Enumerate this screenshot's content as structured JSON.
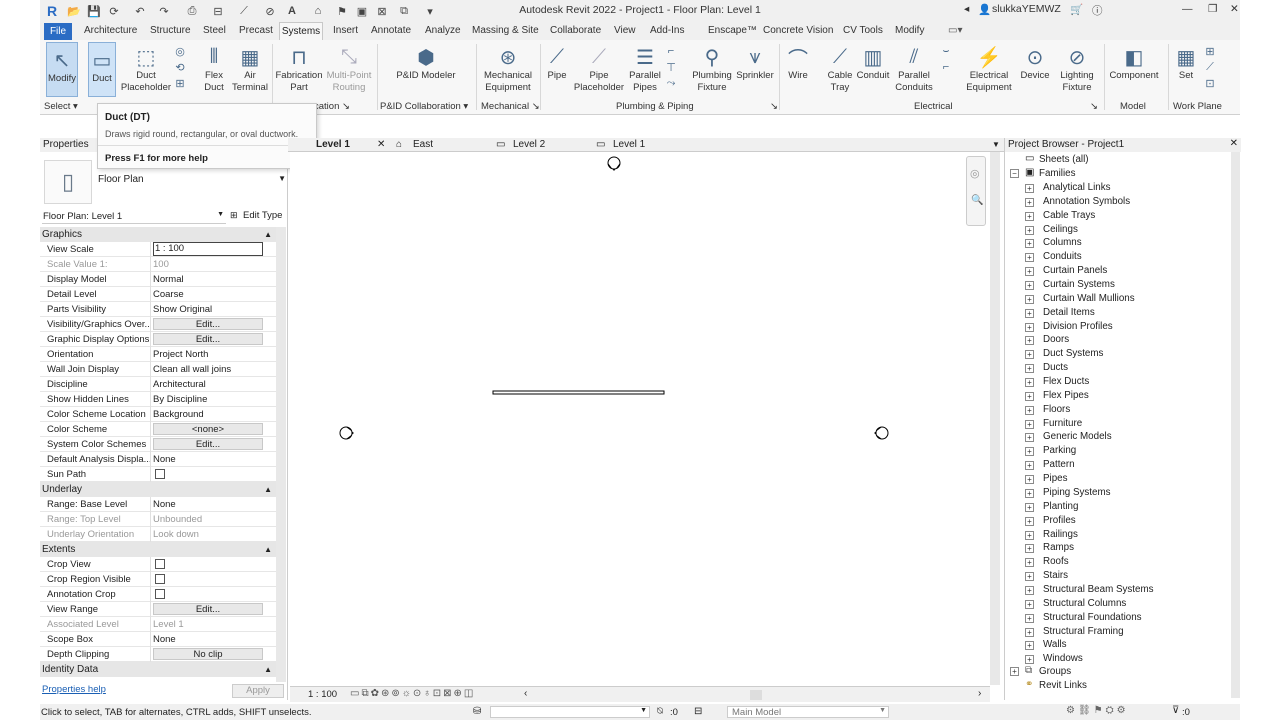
{
  "app": {
    "title": "Autodesk Revit 2022 - Project1 - Floor Plan: Level 1",
    "user": "slukkaYEMWZ",
    "logo": "R"
  },
  "tabs": [
    "File",
    "Architecture",
    "Structure",
    "Steel",
    "Precast",
    "Systems",
    "Insert",
    "Annotate",
    "Analyze",
    "Massing & Site",
    "Collaborate",
    "View",
    "Add-Ins",
    "Enscape™",
    "Concrete Vision",
    "CV Tools",
    "Modify"
  ],
  "ribbon": {
    "buttons": {
      "modify": "Modify",
      "duct": "Duct",
      "duct_placeholder": "Duct\nPlaceholder",
      "flex_duct": "Flex\nDuct",
      "air_terminal": "Air\nTerminal",
      "fabrication_part": "Fabrication\nPart",
      "multi_point_routing": "Multi-Point\nRouting",
      "pid_modeler": "P&ID Modeler",
      "mechanical_equipment": "Mechanical\nEquipment",
      "pipe": "Pipe",
      "pipe_placeholder": "Pipe\nPlaceholder",
      "parallel_pipes": "Parallel\nPipes",
      "plumbing_fixture": "Plumbing\nFixture",
      "sprinkler": "Sprinkler",
      "wire": "Wire",
      "cable_tray": "Cable\nTray",
      "conduit": "Conduit",
      "parallel_conduits": "Parallel\nConduits",
      "electrical_equipment": "Electrical\nEquipment",
      "device": "Device",
      "lighting_fixture": "Lighting\nFixture",
      "component": "Component",
      "set": "Set"
    },
    "panels": {
      "select": "Select",
      "fabrication": "cation",
      "pid": "P&ID Collaboration",
      "mechanical": "Mechanical",
      "plumbing": "Plumbing & Piping",
      "electrical": "Electrical",
      "model": "Model",
      "workplane": "Work Plane"
    }
  },
  "tooltip": {
    "title": "Duct (DT)",
    "description": "Draws rigid round, rectangular, or oval ductwork.",
    "help": "Press F1 for more help"
  },
  "properties": {
    "header": "Properties",
    "type": "Floor Plan",
    "instance": "Floor Plan: Level 1",
    "edit_type": "Edit Type",
    "help_link": "Properties help",
    "apply": "Apply",
    "sections": {
      "graphics": "Graphics",
      "underlay": "Underlay",
      "extents": "Extents",
      "identity": "Identity Data"
    },
    "rows": {
      "view_scale": {
        "k": "View Scale",
        "v": "1 : 100"
      },
      "scale_value": {
        "k": "Scale Value    1:",
        "v": "100"
      },
      "display_model": {
        "k": "Display Model",
        "v": "Normal"
      },
      "detail_level": {
        "k": "Detail Level",
        "v": "Coarse"
      },
      "parts_visibility": {
        "k": "Parts Visibility",
        "v": "Show Original"
      },
      "vis_graphics": {
        "k": "Visibility/Graphics Over...",
        "v": "Edit..."
      },
      "graphic_display": {
        "k": "Graphic Display Options",
        "v": "Edit..."
      },
      "orientation": {
        "k": "Orientation",
        "v": "Project North"
      },
      "wall_join": {
        "k": "Wall Join Display",
        "v": "Clean all wall joins"
      },
      "discipline": {
        "k": "Discipline",
        "v": "Architectural"
      },
      "hidden_lines": {
        "k": "Show Hidden Lines",
        "v": "By Discipline"
      },
      "color_scheme_loc": {
        "k": "Color Scheme Location",
        "v": "Background"
      },
      "color_scheme": {
        "k": "Color Scheme",
        "v": "<none>"
      },
      "system_color": {
        "k": "System Color Schemes",
        "v": "Edit..."
      },
      "default_analysis": {
        "k": "Default Analysis Displa...",
        "v": "None"
      },
      "sun_path": {
        "k": "Sun Path",
        "v": ""
      },
      "range_base": {
        "k": "Range: Base Level",
        "v": "None"
      },
      "range_top": {
        "k": "Range: Top Level",
        "v": "Unbounded"
      },
      "underlay_orient": {
        "k": "Underlay Orientation",
        "v": "Look down"
      },
      "crop_view": {
        "k": "Crop View",
        "v": ""
      },
      "crop_visible": {
        "k": "Crop Region Visible",
        "v": ""
      },
      "annotation_crop": {
        "k": "Annotation Crop",
        "v": ""
      },
      "view_range": {
        "k": "View Range",
        "v": "Edit..."
      },
      "assoc_level": {
        "k": "Associated Level",
        "v": "Level 1"
      },
      "scope_box": {
        "k": "Scope Box",
        "v": "None"
      },
      "depth_clipping": {
        "k": "Depth Clipping",
        "v": "No clip"
      }
    }
  },
  "view_tabs": [
    "Level 1",
    "East",
    "Level 2",
    "Level 1"
  ],
  "browser": {
    "header": "Project Browser - Project1",
    "sheets": "Sheets (all)",
    "families": "Families",
    "family_items": [
      "Analytical Links",
      "Annotation Symbols",
      "Cable Trays",
      "Ceilings",
      "Columns",
      "Conduits",
      "Curtain Panels",
      "Curtain Systems",
      "Curtain Wall Mullions",
      "Detail Items",
      "Division Profiles",
      "Doors",
      "Duct Systems",
      "Ducts",
      "Flex Ducts",
      "Flex Pipes",
      "Floors",
      "Furniture",
      "Generic Models",
      "Parking",
      "Pattern",
      "Pipes",
      "Piping Systems",
      "Planting",
      "Profiles",
      "Railings",
      "Ramps",
      "Roofs",
      "Stairs",
      "Structural Beam Systems",
      "Structural Columns",
      "Structural Foundations",
      "Structural Framing",
      "Walls",
      "Windows"
    ],
    "groups": "Groups",
    "revit_links": "Revit Links"
  },
  "view_control": {
    "scale": "1 : 100"
  },
  "status": {
    "message": "Click to select, TAB for alternates, CTRL adds, SHIFT unselects.",
    "count": ":0",
    "model": "Main Model",
    "filter": ":0"
  }
}
